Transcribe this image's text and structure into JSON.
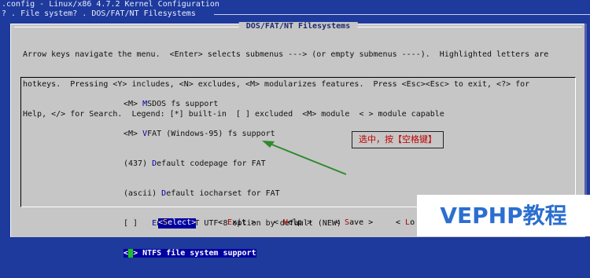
{
  "window": {
    "title": ".config - Linux/x86 4.7.2 Kernel Configuration",
    "breadcrumb": "? . File system? . DOS/FAT/NT Filesystems"
  },
  "dialog": {
    "title": "DOS/FAT/NT Filesystems",
    "help_lines": [
      "Arrow keys navigate the menu.  <Enter> selects submenus ---> (or empty submenus ----).  Highlighted letters are",
      "hotkeys.  Pressing <Y> includes, <N> excludes, <M> modularizes features.  Press <Esc><Esc> to exit, <?> for",
      "Help, </> for Search.  Legend: [*] built-in  [ ] excluded  <M> module  < > module capable"
    ]
  },
  "menu": {
    "items": [
      {
        "prefix": "<M> ",
        "hotkey": "M",
        "rest": "SDOS fs support"
      },
      {
        "prefix": "<M> ",
        "hotkey": "V",
        "rest": "FAT (Windows-95) fs support"
      },
      {
        "prefix": "(437) ",
        "hotkey": "D",
        "rest": "efault codepage for FAT"
      },
      {
        "prefix": "(ascii) ",
        "hotkey": "D",
        "rest": "efault iocharset for FAT"
      },
      {
        "prefix": "[ ]   ",
        "hotkey": "E",
        "rest": "nable FAT UTF-8 option by default (NEW)"
      }
    ],
    "selected": {
      "open": "<",
      "cursor": " ",
      "rest": "> NTFS file system support"
    }
  },
  "annotation": {
    "text": "选中，按【空格键】"
  },
  "buttons": {
    "select": {
      "open": "<",
      "hotkey": "S",
      "rest": "elect>"
    },
    "exit": {
      "open": "< ",
      "hotkey": "E",
      "rest": "xit >"
    },
    "help": {
      "open": "< ",
      "hotkey": "H",
      "rest": "elp >"
    },
    "save": {
      "open": "< ",
      "hotkey": "S",
      "rest": "ave >"
    },
    "load": {
      "open": "< ",
      "hotkey": "L",
      "rest": "o"
    }
  },
  "watermark": {
    "text": "VEPHP教程"
  },
  "colors": {
    "background": "#1e3a9c",
    "dialog": "#c6c6c6",
    "selection": "#0000a0",
    "cursor": "#1ec01e",
    "arrow": "#2f8a2f",
    "annotation_text": "#c00000",
    "watermark_text": "#2b6fd0"
  }
}
